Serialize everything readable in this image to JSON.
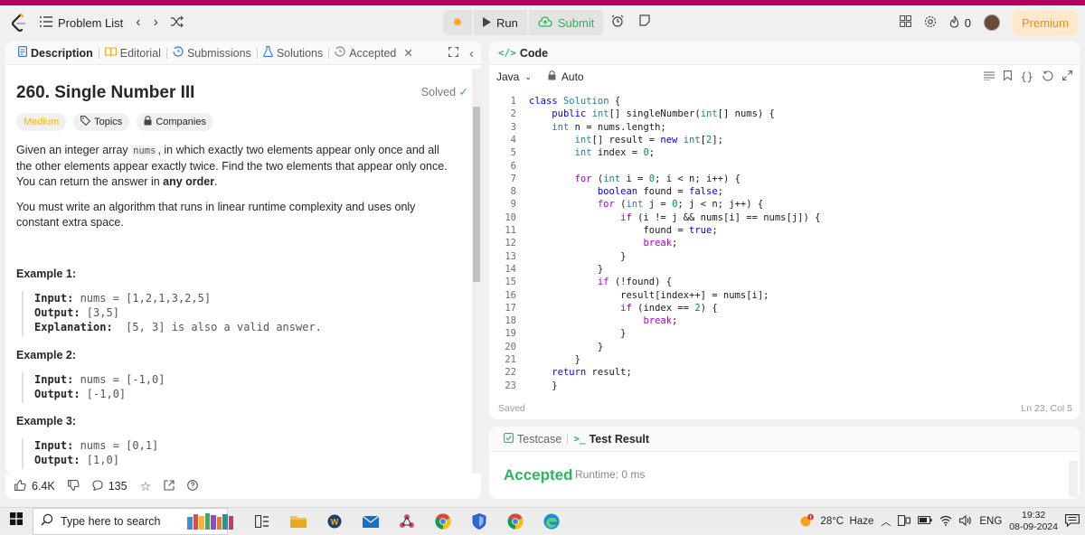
{
  "nav": {
    "problem_list": "Problem List",
    "run": "Run",
    "submit": "Submit",
    "streak": "0",
    "premium": "Premium"
  },
  "left_tabs": {
    "description": "Description",
    "editorial": "Editorial",
    "submissions": "Submissions",
    "solutions": "Solutions",
    "accepted": "Accepted"
  },
  "problem": {
    "title": "260. Single Number III",
    "status": "Solved",
    "difficulty": "Medium",
    "topics": "Topics",
    "companies": "Companies",
    "desc_1": "Given an integer array ",
    "desc_code": "nums",
    "desc_2": ", in which exactly two elements appear only once and all the other elements appear exactly twice. Find the two elements that appear only once. You can return the answer in ",
    "desc_bold": "any order",
    "desc_3": ".",
    "desc_para2": "You must write an algorithm that runs in linear runtime complexity and uses only constant extra space.",
    "examples": [
      {
        "title": "Example 1:",
        "input_label": "Input:",
        "input": " nums = [1,2,1,3,2,5]",
        "output_label": "Output:",
        "output": " [3,5]",
        "expl_label": "Explanation:",
        "expl": "  [5, 3] is also a valid answer."
      },
      {
        "title": "Example 2:",
        "input_label": "Input:",
        "input": " nums = [-1,0]",
        "output_label": "Output:",
        "output": " [-1,0]"
      },
      {
        "title": "Example 3:",
        "input_label": "Input:",
        "input": " nums = [0,1]",
        "output_label": "Output:",
        "output": " [1,0]"
      }
    ]
  },
  "footer": {
    "likes": "6.4K",
    "comments": "135"
  },
  "code": {
    "header": "Code",
    "language": "Java",
    "mode": "Auto",
    "saved": "Saved",
    "cursor": "Ln 23, Col 5",
    "lines": [
      "class Solution {",
      "    public int[] singleNumber(int[] nums) {",
      "    int n = nums.length;",
      "        int[] result = new int[2];",
      "        int index = 0;",
      "",
      "        for (int i = 0; i < n; i++) {",
      "            boolean found = false;",
      "            for (int j = 0; j < n; j++) {",
      "                if (i != j && nums[i] == nums[j]) {",
      "                    found = true;",
      "                    break;",
      "                }",
      "            }",
      "            if (!found) {",
      "                result[index++] = nums[i];",
      "                if (index == 2) {",
      "                    break;",
      "                }",
      "            }",
      "        }",
      "    return result;",
      "    }"
    ]
  },
  "test": {
    "testcase": "Testcase",
    "test_result": "Test Result",
    "result": "Accepted",
    "runtime": "Runtime: 0 ms"
  },
  "taskbar": {
    "search_placeholder": "Type here to search",
    "weather": "28°C  Haze",
    "lang": "ENG",
    "time": "19:32",
    "date": "08-09-2024"
  },
  "colors": {
    "accent_green": "#2db55d",
    "medium_yellow": "#ffb700",
    "premium_orange": "#e58e1b",
    "top_strip": "#b3005e"
  }
}
